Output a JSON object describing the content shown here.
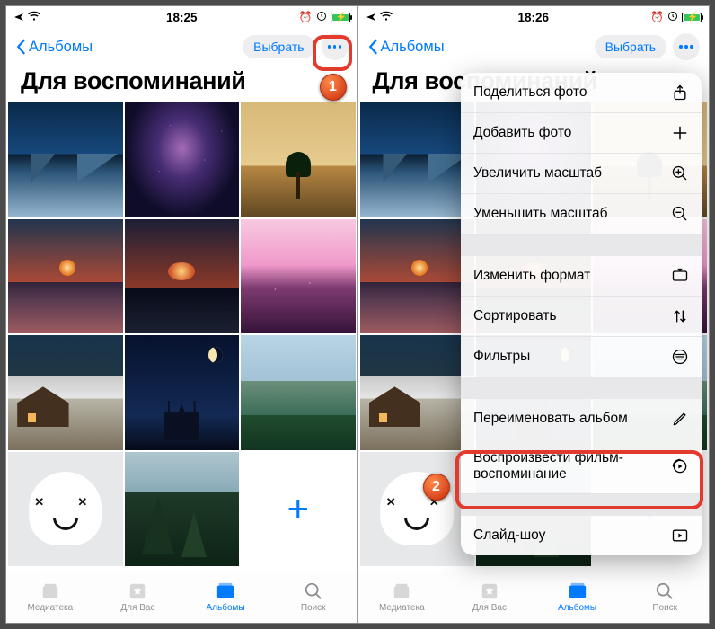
{
  "statusL": {
    "time": "18:25"
  },
  "statusR": {
    "time": "18:26"
  },
  "nav": {
    "back": "Альбомы",
    "select": "Выбрать"
  },
  "title": "Для воспоминаний",
  "tabs": {
    "media": "Медиатека",
    "for_you": "Для Вас",
    "albums": "Альбомы",
    "search": "Поиск"
  },
  "menu": {
    "share": "Поделиться фото",
    "add": "Добавить фото",
    "zoom_in": "Увеличить масштаб",
    "zoom_out": "Уменьшить масштаб",
    "aspect": "Изменить формат",
    "sort": "Сортировать",
    "filters": "Фильтры",
    "rename": "Переименовать альбом",
    "play_memory": "Воспроизвести фильм-воспоминание",
    "slideshow": "Слайд-шоу"
  },
  "badges": {
    "one": "1",
    "two": "2"
  }
}
